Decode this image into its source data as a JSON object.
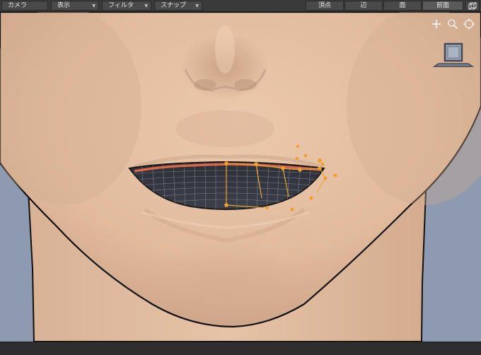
{
  "toolbar": {
    "menus": [
      {
        "label": "カメラ"
      },
      {
        "label": "表示"
      },
      {
        "label": "フィルタ"
      },
      {
        "label": "スナップ"
      }
    ],
    "modes": [
      {
        "label": "頂点"
      },
      {
        "label": "辺"
      },
      {
        "label": "面"
      }
    ],
    "view_label": "前面"
  },
  "navigation": {
    "pan_icon": "plus-icon",
    "zoom_icon": "magnifier-icon",
    "orbit_icon": "crosshair-icon",
    "view_cube_icon": "monitor-icon"
  },
  "colors": {
    "viewport_bg": "#8d9ab0",
    "skin": "#e6c3a6",
    "lip_edge": "#d8664a",
    "vertex": "#f0a030",
    "edge_selection": "#e8a838"
  }
}
